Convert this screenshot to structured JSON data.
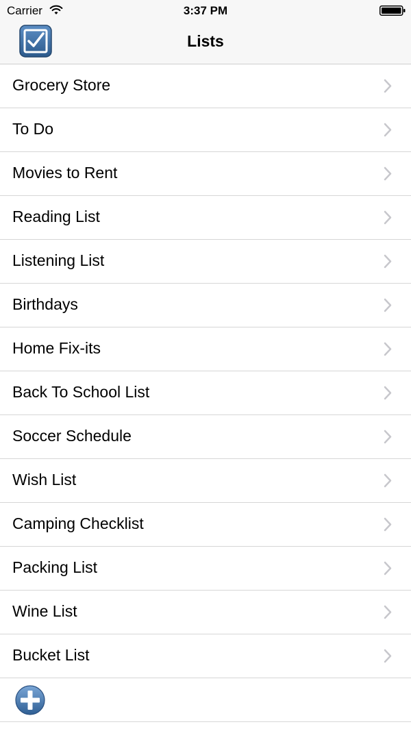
{
  "status_bar": {
    "carrier": "Carrier",
    "time": "3:37 PM",
    "wifi_icon": "wifi-icon",
    "battery_icon": "battery-icon"
  },
  "nav_bar": {
    "title": "Lists",
    "app_icon": "checkbox-checked-icon"
  },
  "lists": [
    {
      "label": "Grocery Store"
    },
    {
      "label": "To Do"
    },
    {
      "label": "Movies to Rent"
    },
    {
      "label": "Reading List"
    },
    {
      "label": "Listening List"
    },
    {
      "label": "Birthdays"
    },
    {
      "label": "Home Fix-its"
    },
    {
      "label": "Back To School List"
    },
    {
      "label": "Soccer Schedule"
    },
    {
      "label": "Wish List"
    },
    {
      "label": "Camping Checklist"
    },
    {
      "label": "Packing List"
    },
    {
      "label": "Wine List"
    },
    {
      "label": "Bucket List"
    }
  ],
  "add_button": {
    "icon": "plus-circle-icon"
  },
  "colors": {
    "bar_background": "#f7f7f7",
    "separator": "#d6d6d6",
    "chevron": "#c7c7cc",
    "accent_blue": "#3a6ea5"
  }
}
